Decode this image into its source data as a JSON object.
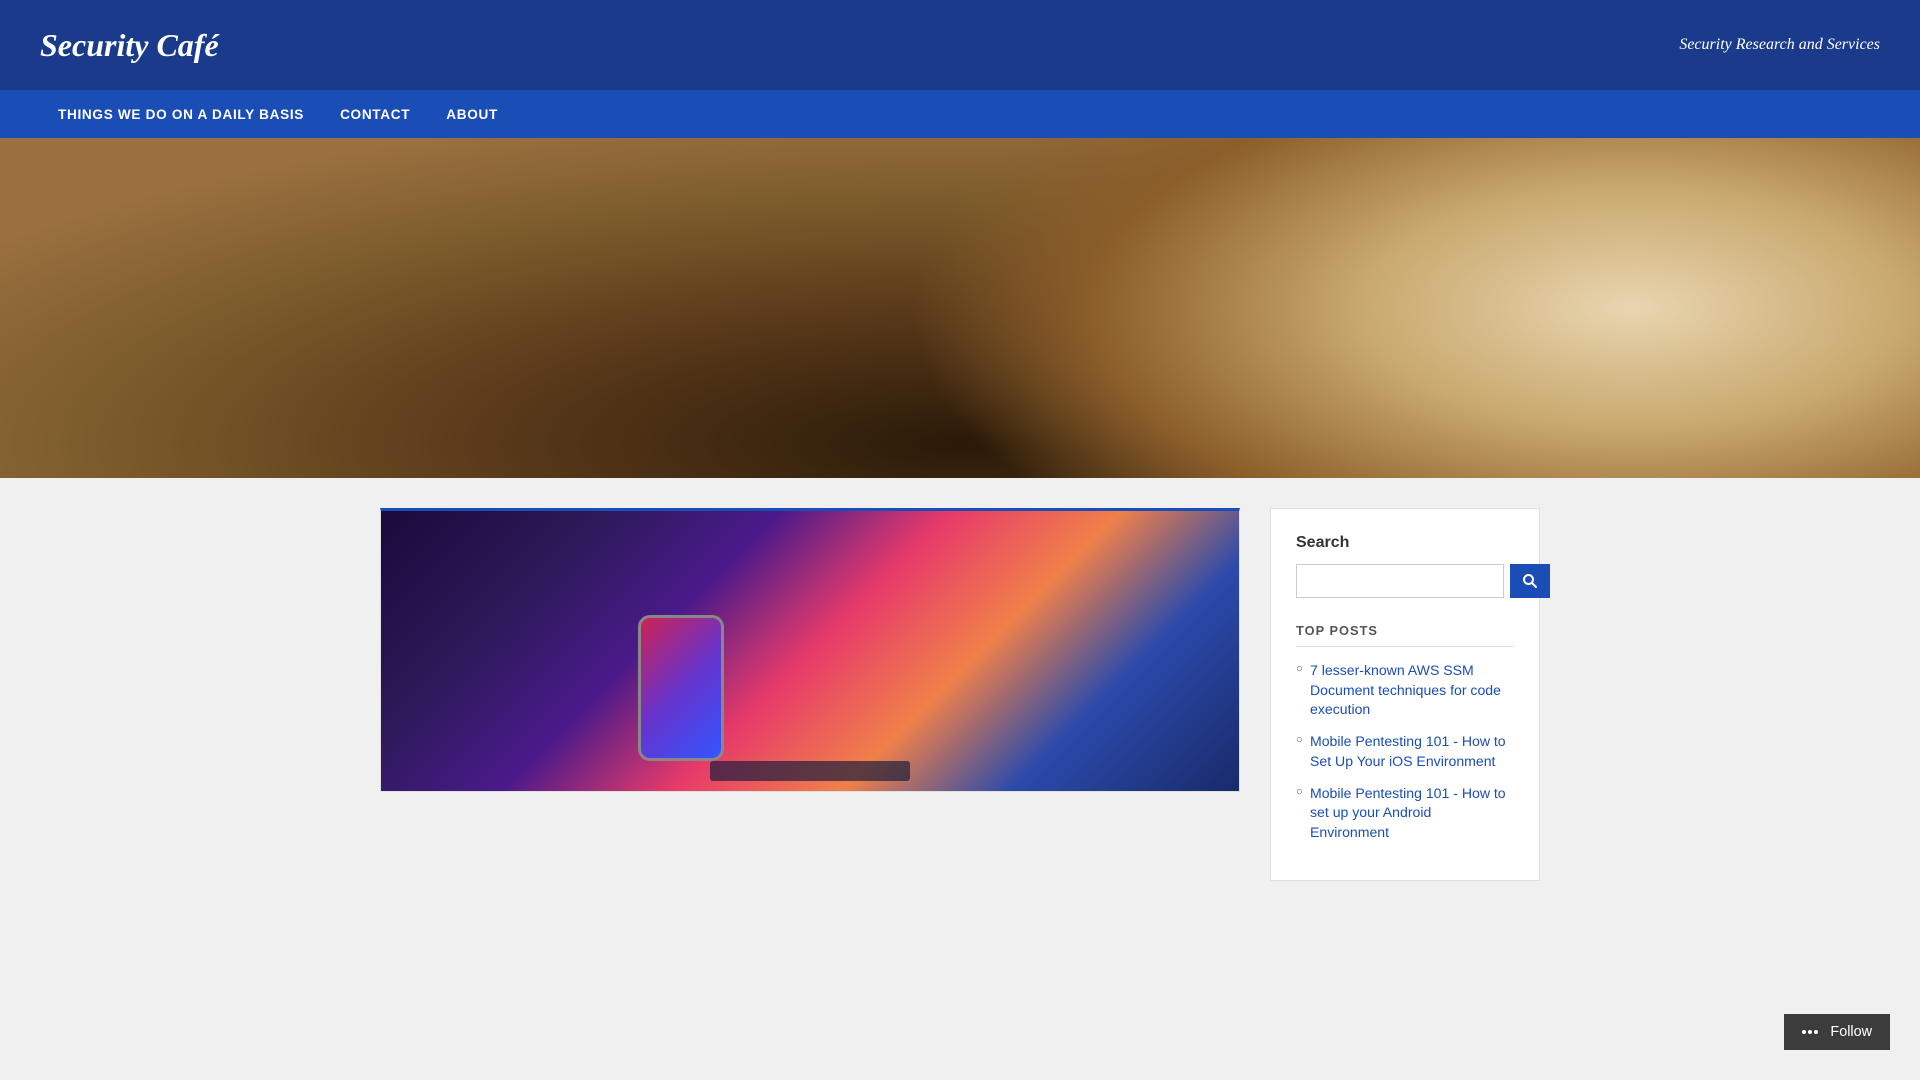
{
  "site": {
    "title": "Security Café",
    "tagline": "Security Research and Services"
  },
  "nav": {
    "items": [
      {
        "label": "THINGS WE DO ON A DAILY BASIS",
        "href": "#"
      },
      {
        "label": "CONTACT",
        "href": "#"
      },
      {
        "label": "ABOUT",
        "href": "#"
      }
    ]
  },
  "sidebar": {
    "search_label": "Search",
    "search_placeholder": "",
    "top_posts_heading": "TOP POSTS",
    "top_posts": [
      {
        "label": "7 lesser-known AWS SSM Document techniques for code execution",
        "href": "#"
      },
      {
        "label": "Mobile Pentesting 101 - How to Set Up Your iOS Environment",
        "href": "#"
      },
      {
        "label": "Mobile Pentesting 101 - How to set up your Android Environment",
        "href": "#"
      }
    ]
  },
  "follow": {
    "label": "Follow"
  },
  "icons": {
    "search": "🔍",
    "follow": "✚"
  }
}
